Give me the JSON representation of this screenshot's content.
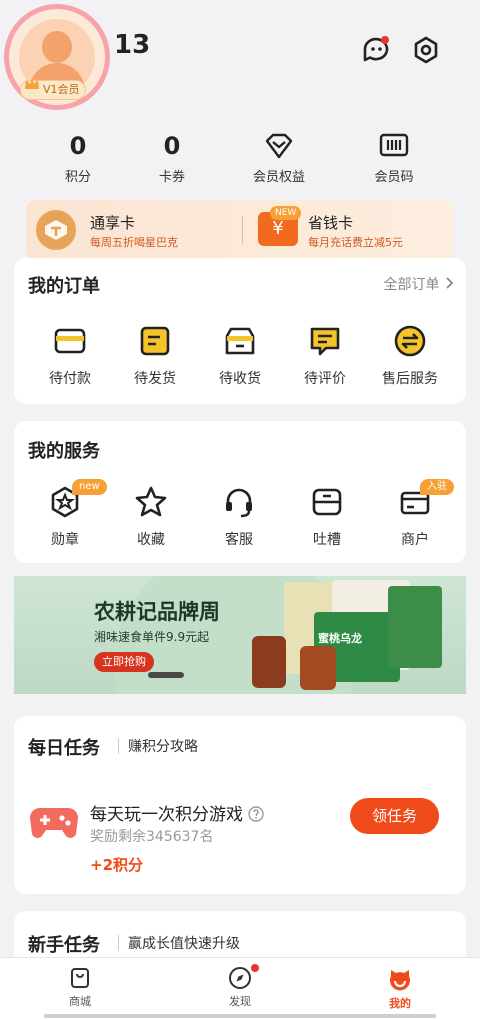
{
  "profile": {
    "username": "13",
    "vip_label": "V1会员"
  },
  "stats": [
    {
      "value": "0",
      "label": "积分"
    },
    {
      "value": "0",
      "label": "卡券"
    },
    {
      "label": "会员权益",
      "icon": "diamond-icon"
    },
    {
      "label": "会员码",
      "icon": "barcode-icon"
    }
  ],
  "promo": {
    "card1_title": "通享卡",
    "card1_sub": "每周五折喝星巴克",
    "card2_tag": "NEW",
    "card2_icon": "¥",
    "card2_title": "省钱卡",
    "card2_sub": "每月充话费立减5元"
  },
  "orders": {
    "title": "我的订单",
    "all_link": "全部订单",
    "items": [
      {
        "label": "待付款",
        "icon": "wallet-icon"
      },
      {
        "label": "待发货",
        "icon": "package-list-icon"
      },
      {
        "label": "待收货",
        "icon": "box-icon"
      },
      {
        "label": "待评价",
        "icon": "comment-icon"
      },
      {
        "label": "售后服务",
        "icon": "exchange-icon"
      }
    ]
  },
  "services": {
    "title": "我的服务",
    "items": [
      {
        "label": "勋章",
        "badge": "new",
        "icon": "medal-icon"
      },
      {
        "label": "收藏",
        "icon": "star-icon"
      },
      {
        "label": "客服",
        "icon": "headset-icon"
      },
      {
        "label": "吐槽",
        "icon": "feedback-icon"
      },
      {
        "label": "商户",
        "badge": "入驻",
        "icon": "merchant-card-icon"
      }
    ]
  },
  "banner": {
    "title": "农耕记品牌周",
    "subtitle": "湘味速食单件9.9元起",
    "button": "立即抢购",
    "product_label": "蜜桃乌龙"
  },
  "daily_tasks": {
    "title": "每日任务",
    "link": "赚积分攻略",
    "task_title": "每天玩一次积分游戏",
    "task_sub": "奖励剩余345637名",
    "reward": "+2积分",
    "button": "领任务"
  },
  "newbie": {
    "title": "新手任务",
    "link": "赢成长值快速升级"
  },
  "tabbar": [
    {
      "label": "商城",
      "icon": "shopping-bag-icon"
    },
    {
      "label": "发现",
      "icon": "compass-icon"
    },
    {
      "label": "我的",
      "icon": "smiley-icon"
    }
  ],
  "colors": {
    "accent": "#f04a1a",
    "badge": "#f7a035",
    "background": "#f2f2f4"
  }
}
